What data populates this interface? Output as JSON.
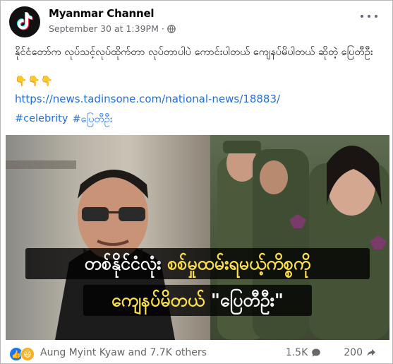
{
  "post": {
    "page_name": "Myanmar Channel",
    "timestamp": "September 30 at 1:39PM",
    "separator": "·",
    "body_text": "နိုင်ငံတော်က လုပ်သင့်လုပ်ထိုက်တာ လုပ်တာပါပဲ ကောင်းပါတယ် ကျေနပ်မိပါတယ် ဆိုတဲ့ ပြေတီဦး",
    "emojis": [
      "👇",
      "👇",
      "👇"
    ],
    "link": "https://news.tadinsone.com/national-news/18883/",
    "hashtags": [
      "#celebrity",
      "#ပြေတီဦး"
    ]
  },
  "image": {
    "caption_line1_white": "တစ်နိုင်ငံလုံး ",
    "caption_line1_yellow": "စစ်မှုထမ်းရမယ့်ကိစ္စကို",
    "caption_line2_yellow": "ကျေနပ်မိတယ် ",
    "caption_line2_white": "\"ပြေတီဦး\""
  },
  "footer": {
    "reactions_text": "Aung Myint Kyaw and 7.7K others",
    "comments_count": "1.5K",
    "shares_count": "200"
  },
  "colors": {
    "link": "#216fdb",
    "text": "#050505",
    "meta": "#65676b",
    "caption_yellow": "#ffe14a",
    "like_blue": "#1877f2"
  },
  "icons": {
    "avatar": "tiktok-logo",
    "privacy": "globe-icon",
    "more": "more-dots-icon",
    "comments": "comment-bubble-icon",
    "shares": "share-arrow-icon"
  }
}
